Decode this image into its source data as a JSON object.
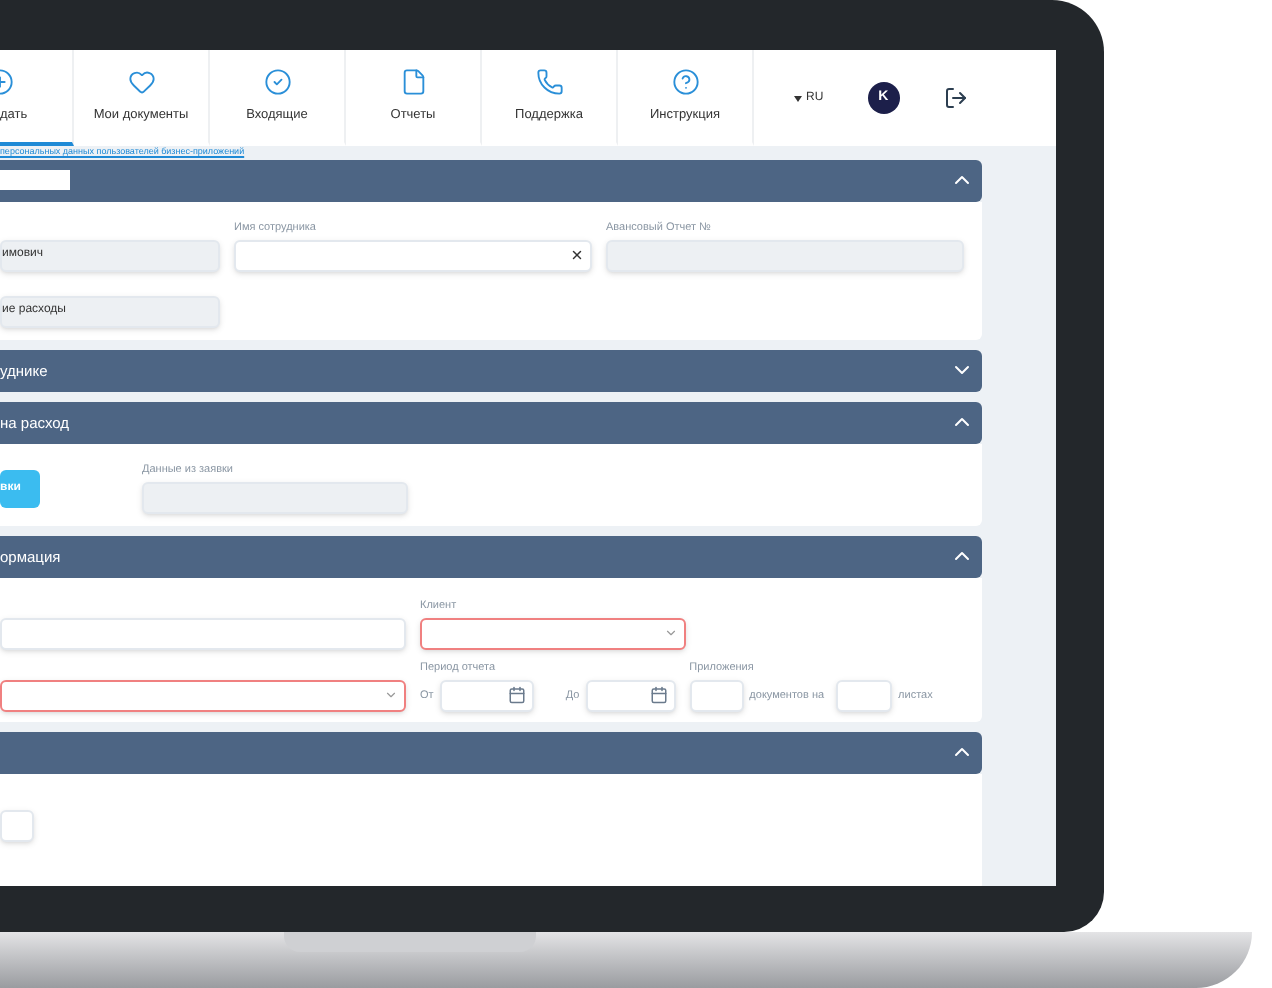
{
  "nav": {
    "tabs": [
      {
        "label": "дать",
        "kind": "create",
        "selected": true
      },
      {
        "label": "Мои документы",
        "kind": "favorites",
        "selected": false
      },
      {
        "label": "Входящие",
        "kind": "inbox",
        "selected": false
      },
      {
        "label": "Отчеты",
        "kind": "reports",
        "selected": false
      },
      {
        "label": "Поддержка",
        "kind": "support",
        "selected": false
      },
      {
        "label": "Инструкция",
        "kind": "help",
        "selected": false
      }
    ],
    "language": "RU",
    "avatar": "K"
  },
  "consent_link": "персональных данных пользователей бизнес-приложений",
  "sections": [
    {
      "title_editable": true,
      "expanded": true,
      "fields": [
        {
          "kind": "readonly",
          "value": "имович"
        },
        {
          "kind": "input",
          "label": "Имя сотрудника",
          "clearable": true
        },
        {
          "kind": "readonly",
          "label": "Авансовый Отчет №"
        },
        {
          "kind": "readonly",
          "value": "ие расходы"
        }
      ]
    },
    {
      "title": "уднике",
      "expanded": false
    },
    {
      "title": "на расход",
      "expanded": true,
      "fields": [
        {
          "kind": "button",
          "label": "вки"
        },
        {
          "kind": "readonly",
          "label": "Данные из заявки"
        }
      ]
    },
    {
      "title": "ормация",
      "expanded": true,
      "fields": [
        {
          "kind": "input"
        },
        {
          "kind": "select",
          "label": "Клиент",
          "invalid": true
        },
        {
          "kind": "select",
          "invalid": true
        },
        {
          "kind": "date",
          "label": "Период отчета",
          "prefix": "От"
        },
        {
          "kind": "date",
          "prefix": "До"
        },
        {
          "kind": "input",
          "label": "Приложения",
          "suffix": "документов на"
        },
        {
          "kind": "input",
          "suffix": "листах"
        }
      ]
    },
    {
      "expanded": true,
      "fields": [
        {
          "kind": "input"
        }
      ]
    }
  ]
}
